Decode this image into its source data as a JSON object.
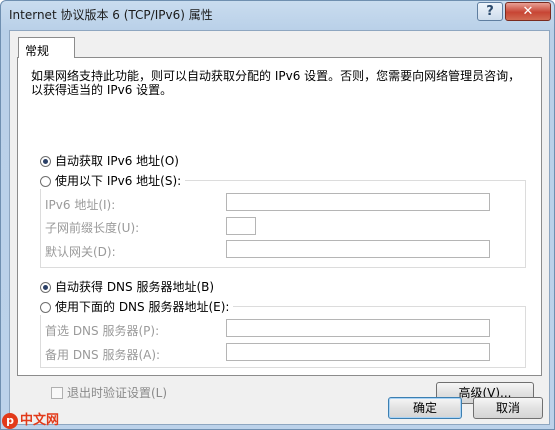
{
  "window": {
    "title": "Internet 协议版本 6 (TCP/IPv6) 属性",
    "help_glyph": "?",
    "close_glyph": "✕"
  },
  "tabs": [
    {
      "label": "常规",
      "active": true
    }
  ],
  "description": "如果网络支持此功能，则可以自动获取分配的 IPv6 设置。否则，您需要向网络管理员咨询，以获得适当的 IPv6 设置。",
  "ip_section": {
    "auto_label": "自动获取 IPv6 地址(O)",
    "auto_selected": true,
    "manual_label": "使用以下 IPv6 地址(S):",
    "fields": [
      {
        "label": "IPv6 地址(I):",
        "value": ""
      },
      {
        "label": "子网前缀长度(U):",
        "value": ""
      },
      {
        "label": "默认网关(D):",
        "value": ""
      }
    ]
  },
  "dns_section": {
    "auto_label": "自动获得 DNS 服务器地址(B)",
    "auto_selected": true,
    "manual_label": "使用下面的 DNS 服务器地址(E):",
    "fields": [
      {
        "label": "首选 DNS 服务器(P):",
        "value": ""
      },
      {
        "label": "备用 DNS 服务器(A):",
        "value": ""
      }
    ]
  },
  "validate_checkbox": {
    "label": "退出时验证设置(L)",
    "checked": false
  },
  "buttons": {
    "advanced": "高级(V)...",
    "ok": "确定",
    "cancel": "取消"
  },
  "watermark": {
    "text": "中文网",
    "logo_letter": "p"
  }
}
